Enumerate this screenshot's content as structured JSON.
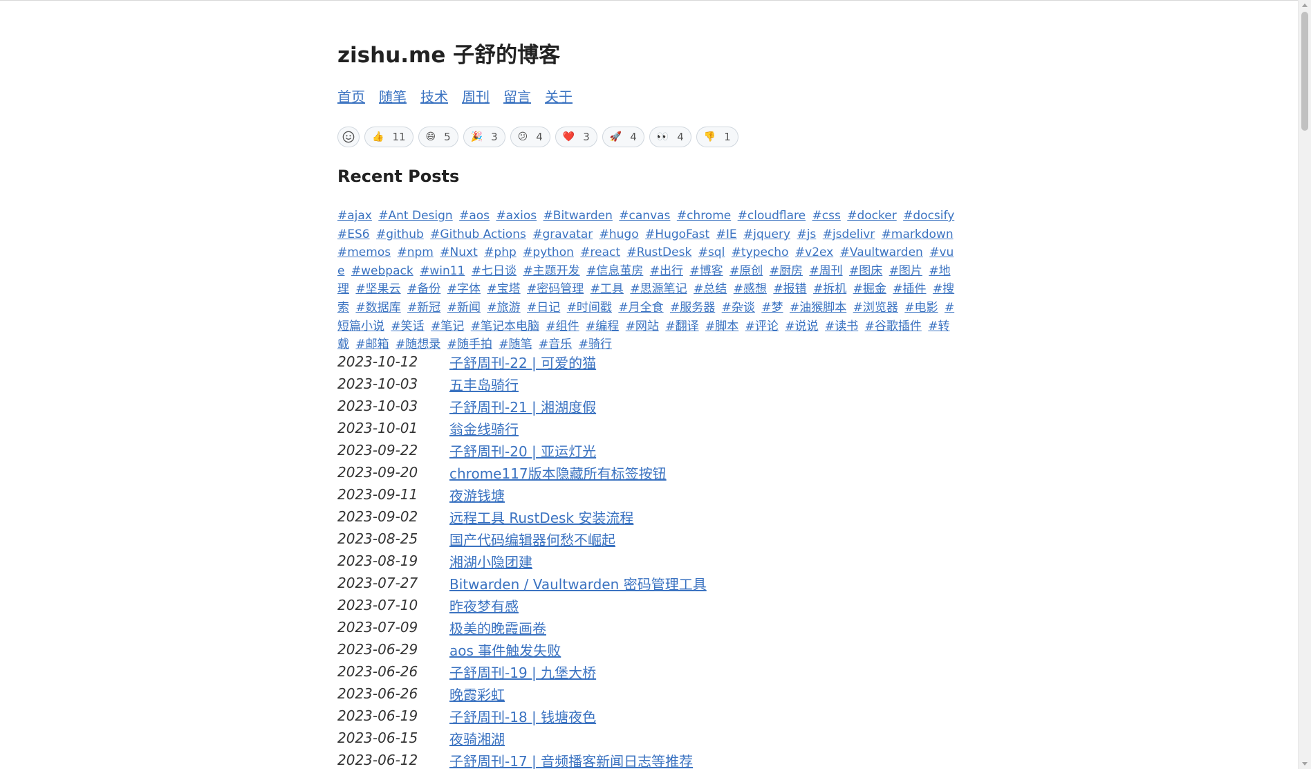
{
  "site": {
    "title": "zishu.me 子舒的博客"
  },
  "nav": {
    "items": [
      "首页",
      "随笔",
      "技术",
      "周刊",
      "留言",
      "关于"
    ]
  },
  "reactions": [
    {
      "icon": "thumbs-up-icon",
      "emoji": "👍",
      "count": "11"
    },
    {
      "icon": "laugh-icon",
      "emoji": "😄",
      "count": "5"
    },
    {
      "icon": "hooray-icon",
      "emoji": "🎉",
      "count": "3"
    },
    {
      "icon": "confused-icon",
      "emoji": "😕",
      "count": "4"
    },
    {
      "icon": "heart-icon",
      "emoji": "❤️",
      "count": "3"
    },
    {
      "icon": "rocket-icon",
      "emoji": "🚀",
      "count": "4"
    },
    {
      "icon": "eyes-icon",
      "emoji": "👀",
      "count": "4"
    },
    {
      "icon": "thumbs-down-icon",
      "emoji": "👎",
      "count": "1"
    }
  ],
  "recent_posts_title": "Recent Posts",
  "tags": [
    "#ajax",
    "#Ant Design",
    "#aos",
    "#axios",
    "#Bitwarden",
    "#canvas",
    "#chrome",
    "#cloudflare",
    "#css",
    "#docker",
    "#docsify",
    "#ES6",
    "#github",
    "#Github Actions",
    "#gravatar",
    "#hugo",
    "#HugoFast",
    "#IE",
    "#jquery",
    "#js",
    "#jsdelivr",
    "#markdown",
    "#memos",
    "#npm",
    "#Nuxt",
    "#php",
    "#python",
    "#react",
    "#RustDesk",
    "#sql",
    "#typecho",
    "#v2ex",
    "#Vaultwarden",
    "#vue",
    "#webpack",
    "#win11",
    "#七日谈",
    "#主题开发",
    "#信息茧房",
    "#出行",
    "#博客",
    "#原创",
    "#厨房",
    "#周刊",
    "#图床",
    "#图片",
    "#地理",
    "#坚果云",
    "#备份",
    "#字体",
    "#宝塔",
    "#密码管理",
    "#工具",
    "#思源笔记",
    "#总结",
    "#感想",
    "#报错",
    "#拆机",
    "#掘金",
    "#插件",
    "#搜索",
    "#数据库",
    "#新冠",
    "#新闻",
    "#旅游",
    "#日记",
    "#时间戳",
    "#月全食",
    "#服务器",
    "#杂谈",
    "#梦",
    "#油猴脚本",
    "#浏览器",
    "#电影",
    "#短篇小说",
    "#笑话",
    "#笔记",
    "#笔记本电脑",
    "#组件",
    "#编程",
    "#网站",
    "#翻译",
    "#脚本",
    "#评论",
    "#说说",
    "#读书",
    "#谷歌插件",
    "#转载",
    "#邮箱",
    "#随想录",
    "#随手拍",
    "#随笔",
    "#音乐",
    "#骑行"
  ],
  "posts": [
    {
      "date": "2023-10-12",
      "title": "子舒周刊-22 | 可爱的猫"
    },
    {
      "date": "2023-10-03",
      "title": "五丰岛骑行"
    },
    {
      "date": "2023-10-03",
      "title": "子舒周刊-21 | 湘湖度假"
    },
    {
      "date": "2023-10-01",
      "title": "翁金线骑行"
    },
    {
      "date": "2023-09-22",
      "title": "子舒周刊-20 | 亚运灯光"
    },
    {
      "date": "2023-09-20",
      "title": "chrome117版本隐藏所有标签按钮"
    },
    {
      "date": "2023-09-11",
      "title": "夜游钱塘"
    },
    {
      "date": "2023-09-02",
      "title": "远程工具 RustDesk 安装流程"
    },
    {
      "date": "2023-08-25",
      "title": "国产代码编辑器何愁不崛起"
    },
    {
      "date": "2023-08-19",
      "title": "湘湖小隐团建"
    },
    {
      "date": "2023-07-27",
      "title": "Bitwarden / Vaultwarden 密码管理工具"
    },
    {
      "date": "2023-07-10",
      "title": "昨夜梦有感"
    },
    {
      "date": "2023-07-09",
      "title": "极美的晚霞画卷"
    },
    {
      "date": "2023-06-29",
      "title": "aos 事件触发失败"
    },
    {
      "date": "2023-06-26",
      "title": "子舒周刊-19 | 九堡大桥"
    },
    {
      "date": "2023-06-26",
      "title": "晚霞彩虹"
    },
    {
      "date": "2023-06-19",
      "title": "子舒周刊-18 | 钱塘夜色"
    },
    {
      "date": "2023-06-15",
      "title": "夜骑湘湖"
    },
    {
      "date": "2023-06-12",
      "title": "子舒周刊-17 | 音频播客新闻日志等推荐"
    }
  ],
  "colors": {
    "link": "#3b73c1",
    "text": "#222222",
    "reaction_bg": "#f6f8fa",
    "reaction_border": "#d0d7de"
  }
}
